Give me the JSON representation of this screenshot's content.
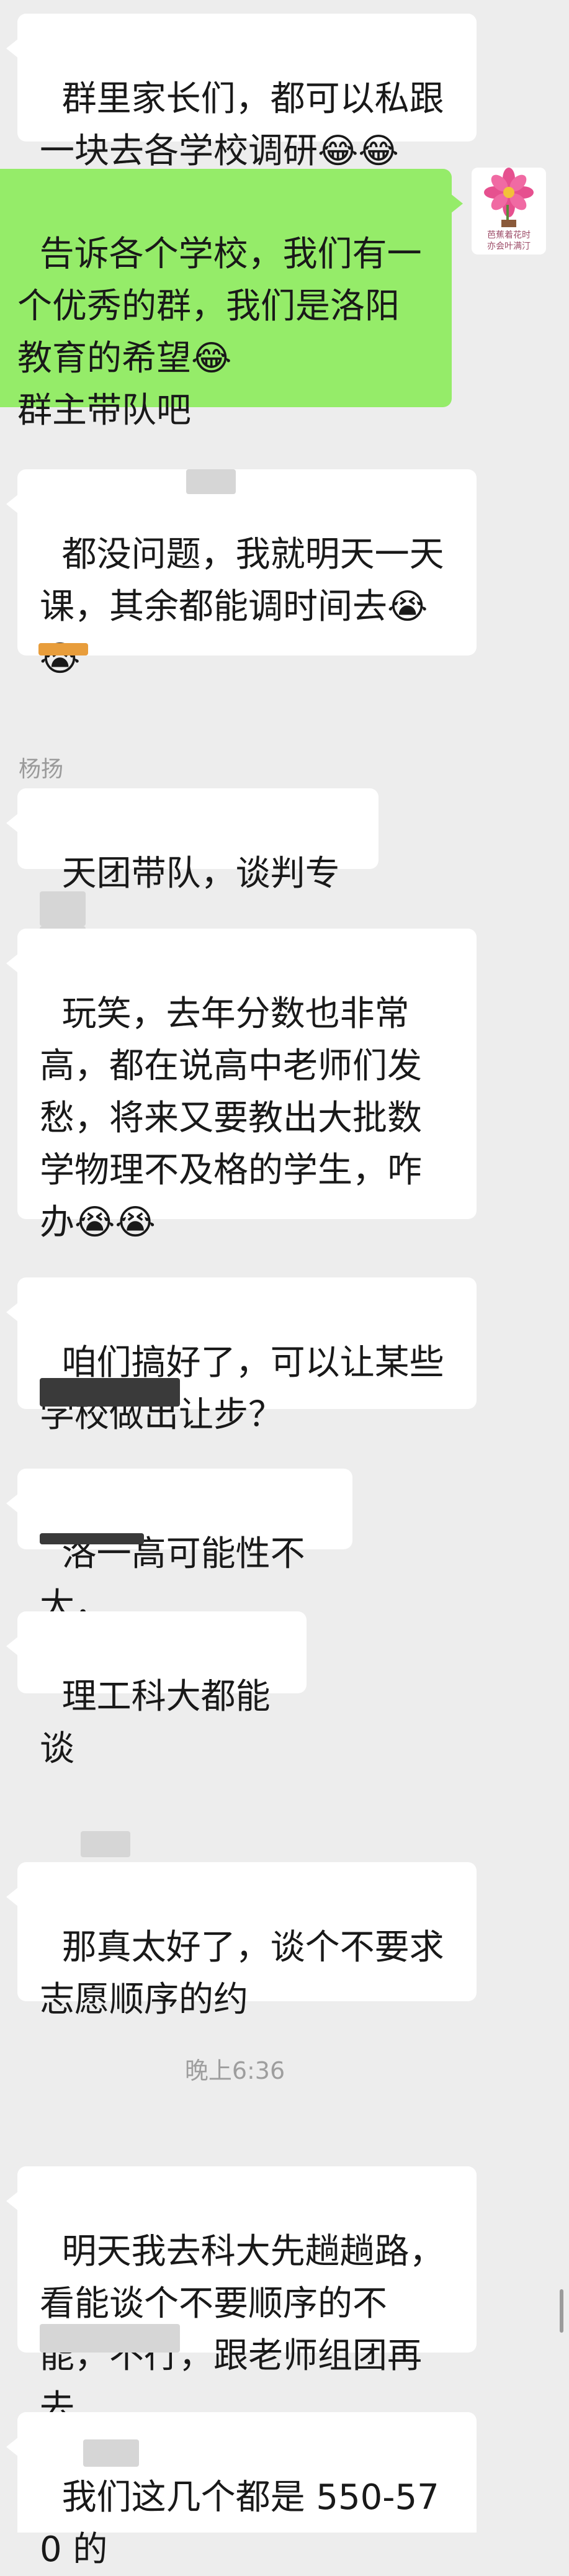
{
  "messages": [
    {
      "sender": "",
      "text": "群里家长们，都可以私跟一块去各学校调研😂😂"
    },
    {
      "sender": "self",
      "text": "告诉各个学校，我们有一个优秀的群，我们是洛阳教育的希望😂\n群主带队吧"
    },
    {
      "sender": "",
      "text": "都没问题，我就明天一天课，其余都能调时间去😭😭"
    },
    {
      "sender": "杨扬",
      "text": "天团带队，谈判专家"
    },
    {
      "sender": "",
      "text": "玩笑，去年分数也非常高，都在说高中老师们发愁，将来又要教出大批数学物理不及格的学生，咋办😭😭"
    },
    {
      "sender": "",
      "text": "咱们搞好了，可以让某些学校做出让步？"
    },
    {
      "sender": "",
      "text": "洛一高可能性不大，"
    },
    {
      "sender": "",
      "text": "理工科大都能谈"
    },
    {
      "sender": "",
      "text": "那真太好了，谈个不要求志愿顺序的约"
    },
    {
      "sender": "",
      "text": "明天我去科大先趟趟路，看能谈个不要顺序的不能，不行，跟老师组团再去"
    },
    {
      "sender": "",
      "text": "我们这几个都是 550-570 的"
    }
  ],
  "timestamp": "晚上6:36",
  "avatar": {
    "caption_line1": "芭蕉着花时",
    "caption_line2": "亦会叶满汀"
  },
  "colors": {
    "self_bubble": "#95ec69",
    "other_bubble": "#ffffff",
    "background": "#ededed"
  }
}
